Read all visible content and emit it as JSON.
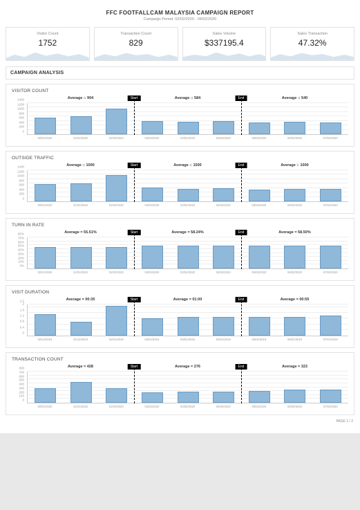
{
  "header": {
    "title": "FFC FOOTFALLCAM MALAYSIA CAMPAIGN REPORT",
    "subtitle": "Campaign Period: 02/02/2020 - 04/02/2020"
  },
  "kpis": [
    {
      "label": "Visitor Count",
      "value": "1752"
    },
    {
      "label": "Transaction Count",
      "value": "829"
    },
    {
      "label": "Sales Volume",
      "value": "$337195.4"
    },
    {
      "label": "Sales Transaction",
      "value": "47.32%"
    }
  ],
  "section_title": "CAMPAIGN ANALYSIS",
  "footer": "PAGE 1 / 2",
  "chart_data": [
    {
      "id": "visitor-count",
      "title": "VISITOR COUNT",
      "type": "bar",
      "categories": [
        "30/01/2020",
        "31/01/2020",
        "01/02/2020",
        "02/02/2020",
        "03/02/2020",
        "04/02/2020",
        "05/02/2020",
        "06/02/2020",
        "07/02/2020"
      ],
      "values": [
        760,
        800,
        1150,
        600,
        560,
        590,
        520,
        560,
        540
      ],
      "yticks": [
        0,
        200,
        400,
        600,
        800,
        1000,
        1200,
        1400
      ],
      "ymax": 1400,
      "segments": [
        {
          "label": "Average :: 904",
          "span": 3
        },
        {
          "label": "Average :: 584",
          "span": 3
        },
        {
          "label": "Average :: 540",
          "span": 3
        }
      ],
      "dividers": [
        {
          "after": 3,
          "tag": "Start"
        },
        {
          "after": 6,
          "tag": "End"
        }
      ]
    },
    {
      "id": "outside-traffic",
      "title": "OUTSIDE TRAFFIC",
      "type": "bar",
      "categories": [
        "30/01/2020",
        "31/01/2020",
        "01/02/2020",
        "02/02/2020",
        "03/02/2020",
        "04/02/2020",
        "05/02/2020",
        "06/02/2020",
        "07/02/2020"
      ],
      "values": [
        780,
        820,
        1180,
        620,
        560,
        600,
        530,
        570,
        560
      ],
      "yticks": [
        0,
        200,
        400,
        600,
        800,
        1000,
        1200,
        1400
      ],
      "ymax": 1400,
      "segments": [
        {
          "label": "Average :: 1000",
          "span": 3
        },
        {
          "label": "Average :: 1500",
          "span": 3
        },
        {
          "label": "Average :: 1000",
          "span": 3
        }
      ],
      "dividers": [
        {
          "after": 3,
          "tag": "Start"
        },
        {
          "after": 6,
          "tag": "End"
        }
      ]
    },
    {
      "id": "turn-in-rate",
      "title": "TURN IN RATE",
      "type": "bar",
      "categories": [
        "30/01/2020",
        "31/01/2020",
        "01/02/2020",
        "02/02/2020",
        "03/02/2020",
        "04/02/2020",
        "05/02/2020",
        "06/02/2020",
        "07/02/2020"
      ],
      "values": [
        56,
        56,
        55,
        58,
        58,
        59,
        58,
        59,
        59
      ],
      "yticks": [
        "0%",
        "10%",
        "20%",
        "30%",
        "40%",
        "50%",
        "60%",
        "70%",
        "80%"
      ],
      "ymax": 80,
      "segments": [
        {
          "label": "Average = 55.51%",
          "span": 3
        },
        {
          "label": "Average = 58.24%",
          "span": 3
        },
        {
          "label": "Average = 58.50%",
          "span": 3
        }
      ],
      "dividers": [
        {
          "after": 3,
          "tag": "Start"
        },
        {
          "after": 6,
          "tag": "End"
        }
      ]
    },
    {
      "id": "visit-duration",
      "title": "VISIT DURATION",
      "type": "bar",
      "categories": [
        "30/12/2019",
        "31/12/2019",
        "01/01/2019",
        "02/01/2019",
        "03/01/2019",
        "04/01/2019",
        "05/01/2019",
        "06/01/2019",
        "07/01/2019"
      ],
      "values": [
        1.5,
        1.0,
        2.1,
        1.2,
        1.3,
        1.3,
        1.3,
        1.3,
        1.4
      ],
      "yticks": [
        0,
        0.4,
        0.8,
        1.2,
        1.6,
        2.0,
        2.2
      ],
      "ymax": 2.2,
      "segments": [
        {
          "label": "Average = 00:35",
          "span": 3
        },
        {
          "label": "Average = 01:00",
          "span": 3
        },
        {
          "label": "Average = 00:55",
          "span": 3
        }
      ],
      "dividers": [
        {
          "after": 3,
          "tag": "Start"
        },
        {
          "after": 6,
          "tag": "End"
        }
      ]
    },
    {
      "id": "transaction-count",
      "title": "TRANSACTION COUNT",
      "type": "bar",
      "categories": [
        "30/01/2020",
        "31/01/2020",
        "01/02/2020",
        "02/02/2020",
        "03/02/2020",
        "04/02/2020",
        "05/02/2020",
        "06/02/2020",
        "07/02/2020"
      ],
      "values": [
        370,
        530,
        380,
        260,
        280,
        290,
        310,
        330,
        330
      ],
      "yticks": [
        0,
        100,
        200,
        300,
        400,
        500,
        600,
        700,
        800
      ],
      "ymax": 800,
      "segments": [
        {
          "label": "Average = 428",
          "span": 3
        },
        {
          "label": "Average = 276",
          "span": 3
        },
        {
          "label": "Average = 323",
          "span": 3
        }
      ],
      "dividers": [
        {
          "after": 3,
          "tag": "Start"
        },
        {
          "after": 6,
          "tag": "End"
        }
      ]
    }
  ]
}
